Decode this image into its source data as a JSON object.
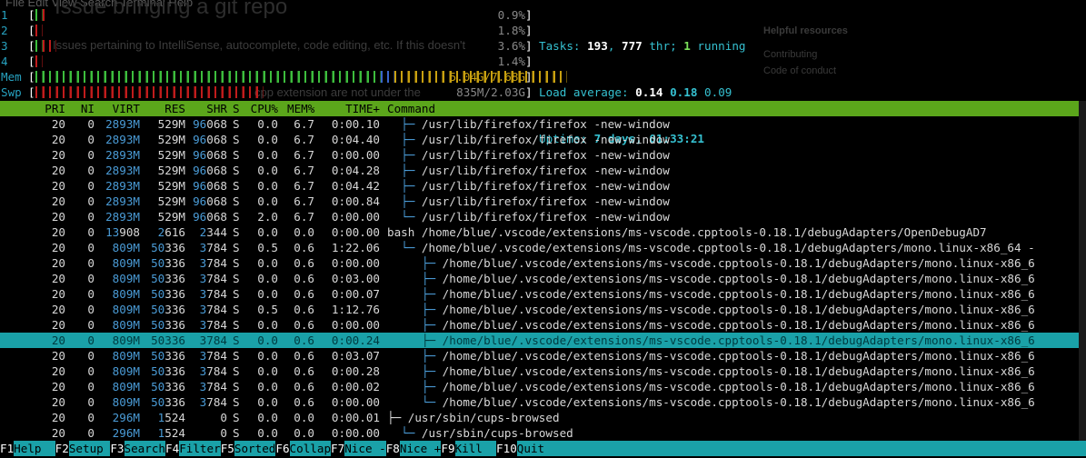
{
  "background_window": {
    "menu": "File  Edit  View  Search  Terminal  Help",
    "heading": "Issue bringing a git repo",
    "body_line": "Issues pertaining to IntelliSense, autocomplete, code editing, etc. If this doesn't",
    "swap_overlay": "cpp extension are not under the",
    "side_title": "Helpful resources",
    "side_link1": "Contributing",
    "side_link2": "Code of conduct"
  },
  "meters": [
    {
      "label": "1",
      "value": "0.9%",
      "segments": [
        {
          "color": "#3dbd3d",
          "w": 1
        },
        {
          "color": "#c01c1c",
          "w": 1
        }
      ]
    },
    {
      "label": "2",
      "value": "1.8%",
      "segments": [
        {
          "color": "#c01c1c",
          "w": 1
        }
      ]
    },
    {
      "label": "3",
      "value": "3.6%",
      "segments": [
        {
          "color": "#3dbd3d",
          "w": 1
        },
        {
          "color": "#c01c1c",
          "w": 2
        }
      ]
    },
    {
      "label": "4",
      "value": "1.4%",
      "segments": [
        {
          "color": "#c01c1c",
          "w": 1
        }
      ]
    },
    {
      "label": "Mem",
      "value": "5.04G/7.68G",
      "segments": [
        {
          "color": "#3dbd3d",
          "w": 50
        },
        {
          "color": "#3a66cc",
          "w": 2
        },
        {
          "color": "#c8a010",
          "w": 25
        }
      ]
    },
    {
      "label": "Swp",
      "value": "835M/2.03G",
      "segments": [
        {
          "color": "#c01c1c",
          "w": 33
        }
      ]
    }
  ],
  "stats": {
    "tasks_label": "Tasks: ",
    "tasks": "193",
    "thr": "777",
    "thr_label": " thr; ",
    "running": "1",
    "running_label": " running",
    "load_label": "Load average: ",
    "load1": "0.14",
    "load5": "0.18",
    "load15": "0.09",
    "uptime_label": "Uptime: ",
    "uptime": "7 days, 01:33:21"
  },
  "columns": {
    "pri": "PRI",
    "ni": "NI",
    "virt": "VIRT",
    "res": "RES",
    "shr": "SHR",
    "s": "S",
    "cpu": "CPU%",
    "mem": "MEM%",
    "time": "TIME+",
    "cmd": "Command"
  },
  "rows": [
    {
      "pri": "20",
      "ni": "0",
      "virt": "2893M",
      "res": "529M",
      "shr": "96068",
      "s": "S",
      "cpu": "0.0",
      "mem": "6.7",
      "time": "0:00.10",
      "tree": "  ├─ ",
      "cmd": "/usr/lib/firefox/firefox -new-window"
    },
    {
      "pri": "20",
      "ni": "0",
      "virt": "2893M",
      "res": "529M",
      "shr": "96068",
      "s": "S",
      "cpu": "0.0",
      "mem": "6.7",
      "time": "0:04.40",
      "tree": "  ├─ ",
      "cmd": "/usr/lib/firefox/firefox -new-window"
    },
    {
      "pri": "20",
      "ni": "0",
      "virt": "2893M",
      "res": "529M",
      "shr": "96068",
      "s": "S",
      "cpu": "0.0",
      "mem": "6.7",
      "time": "0:00.00",
      "tree": "  ├─ ",
      "cmd": "/usr/lib/firefox/firefox -new-window"
    },
    {
      "pri": "20",
      "ni": "0",
      "virt": "2893M",
      "res": "529M",
      "shr": "96068",
      "s": "S",
      "cpu": "0.0",
      "mem": "6.7",
      "time": "0:04.28",
      "tree": "  ├─ ",
      "cmd": "/usr/lib/firefox/firefox -new-window"
    },
    {
      "pri": "20",
      "ni": "0",
      "virt": "2893M",
      "res": "529M",
      "shr": "96068",
      "s": "S",
      "cpu": "0.0",
      "mem": "6.7",
      "time": "0:04.42",
      "tree": "  ├─ ",
      "cmd": "/usr/lib/firefox/firefox -new-window"
    },
    {
      "pri": "20",
      "ni": "0",
      "virt": "2893M",
      "res": "529M",
      "shr": "96068",
      "s": "S",
      "cpu": "0.0",
      "mem": "6.7",
      "time": "0:00.84",
      "tree": "  ├─ ",
      "cmd": "/usr/lib/firefox/firefox -new-window"
    },
    {
      "pri": "20",
      "ni": "0",
      "virt": "2893M",
      "res": "529M",
      "shr": "96068",
      "s": "S",
      "cpu": "2.0",
      "mem": "6.7",
      "time": "0:00.00",
      "tree": "  └─ ",
      "cmd": "/usr/lib/firefox/firefox -new-window"
    },
    {
      "pri": "20",
      "ni": "0",
      "virt": "13908",
      "res": "2616",
      "shr": "2344",
      "s": "S",
      "cpu": "0.0",
      "mem": "0.0",
      "time": "0:00.00",
      "tree": "",
      "cmd": "bash /home/blue/.vscode/extensions/ms-vscode.cpptools-0.18.1/debugAdapters/OpenDebugAD7"
    },
    {
      "pri": "20",
      "ni": "0",
      "virt": "809M",
      "res": "50336",
      "shr": "3784",
      "s": "S",
      "cpu": "0.5",
      "mem": "0.6",
      "time": "1:22.06",
      "tree": "  └─ ",
      "cmd": "/home/blue/.vscode/extensions/ms-vscode.cpptools-0.18.1/debugAdapters/mono.linux-x86_64 -"
    },
    {
      "pri": "20",
      "ni": "0",
      "virt": "809M",
      "res": "50336",
      "shr": "3784",
      "s": "S",
      "cpu": "0.0",
      "mem": "0.6",
      "time": "0:00.00",
      "tree": "     ├─ ",
      "cmd": "/home/blue/.vscode/extensions/ms-vscode.cpptools-0.18.1/debugAdapters/mono.linux-x86_6"
    },
    {
      "pri": "20",
      "ni": "0",
      "virt": "809M",
      "res": "50336",
      "shr": "3784",
      "s": "S",
      "cpu": "0.0",
      "mem": "0.6",
      "time": "0:03.00",
      "tree": "     ├─ ",
      "cmd": "/home/blue/.vscode/extensions/ms-vscode.cpptools-0.18.1/debugAdapters/mono.linux-x86_6"
    },
    {
      "pri": "20",
      "ni": "0",
      "virt": "809M",
      "res": "50336",
      "shr": "3784",
      "s": "S",
      "cpu": "0.0",
      "mem": "0.6",
      "time": "0:00.07",
      "tree": "     ├─ ",
      "cmd": "/home/blue/.vscode/extensions/ms-vscode.cpptools-0.18.1/debugAdapters/mono.linux-x86_6"
    },
    {
      "pri": "20",
      "ni": "0",
      "virt": "809M",
      "res": "50336",
      "shr": "3784",
      "s": "S",
      "cpu": "0.5",
      "mem": "0.6",
      "time": "1:12.76",
      "tree": "     ├─ ",
      "cmd": "/home/blue/.vscode/extensions/ms-vscode.cpptools-0.18.1/debugAdapters/mono.linux-x86_6"
    },
    {
      "pri": "20",
      "ni": "0",
      "virt": "809M",
      "res": "50336",
      "shr": "3784",
      "s": "S",
      "cpu": "0.0",
      "mem": "0.6",
      "time": "0:00.00",
      "tree": "     ├─ ",
      "cmd": "/home/blue/.vscode/extensions/ms-vscode.cpptools-0.18.1/debugAdapters/mono.linux-x86_6"
    },
    {
      "pri": "20",
      "ni": "0",
      "virt": "809M",
      "res": "50336",
      "shr": "3784",
      "s": "S",
      "cpu": "0.0",
      "mem": "0.6",
      "time": "0:00.24",
      "tree": "     ├─ ",
      "cmd": "/home/blue/.vscode/extensions/ms-vscode.cpptools-0.18.1/debugAdapters/mono.linux-x86_6",
      "selected": true
    },
    {
      "pri": "20",
      "ni": "0",
      "virt": "809M",
      "res": "50336",
      "shr": "3784",
      "s": "S",
      "cpu": "0.0",
      "mem": "0.6",
      "time": "0:03.07",
      "tree": "     ├─ ",
      "cmd": "/home/blue/.vscode/extensions/ms-vscode.cpptools-0.18.1/debugAdapters/mono.linux-x86_6"
    },
    {
      "pri": "20",
      "ni": "0",
      "virt": "809M",
      "res": "50336",
      "shr": "3784",
      "s": "S",
      "cpu": "0.0",
      "mem": "0.6",
      "time": "0:00.28",
      "tree": "     ├─ ",
      "cmd": "/home/blue/.vscode/extensions/ms-vscode.cpptools-0.18.1/debugAdapters/mono.linux-x86_6"
    },
    {
      "pri": "20",
      "ni": "0",
      "virt": "809M",
      "res": "50336",
      "shr": "3784",
      "s": "S",
      "cpu": "0.0",
      "mem": "0.6",
      "time": "0:00.02",
      "tree": "     ├─ ",
      "cmd": "/home/blue/.vscode/extensions/ms-vscode.cpptools-0.18.1/debugAdapters/mono.linux-x86_6"
    },
    {
      "pri": "20",
      "ni": "0",
      "virt": "809M",
      "res": "50336",
      "shr": "3784",
      "s": "S",
      "cpu": "0.0",
      "mem": "0.6",
      "time": "0:00.00",
      "tree": "     └─ ",
      "cmd": "/home/blue/.vscode/extensions/ms-vscode.cpptools-0.18.1/debugAdapters/mono.linux-x86_6"
    },
    {
      "pri": "20",
      "ni": "0",
      "virt": "296M",
      "res": "1524",
      "shr": "0",
      "s": "S",
      "cpu": "0.0",
      "mem": "0.0",
      "time": "0:00.01",
      "tree": "",
      "cmd": "├─ /usr/sbin/cups-browsed"
    },
    {
      "pri": "20",
      "ni": "0",
      "virt": "296M",
      "res": "1524",
      "shr": "0",
      "s": "S",
      "cpu": "0.0",
      "mem": "0.0",
      "time": "0:00.00",
      "tree": "  └─ ",
      "cmd": "/usr/sbin/cups-browsed"
    }
  ],
  "fkeys": [
    {
      "key": "F1",
      "label": "Help  "
    },
    {
      "key": "F2",
      "label": "Setup "
    },
    {
      "key": "F3",
      "label": "Search"
    },
    {
      "key": "F4",
      "label": "Filter"
    },
    {
      "key": "F5",
      "label": "Sorted"
    },
    {
      "key": "F6",
      "label": "Collap"
    },
    {
      "key": "F7",
      "label": "Nice -"
    },
    {
      "key": "F8",
      "label": "Nice +"
    },
    {
      "key": "F9",
      "label": "Kill  "
    },
    {
      "key": "F10",
      "label": "Quit"
    }
  ]
}
